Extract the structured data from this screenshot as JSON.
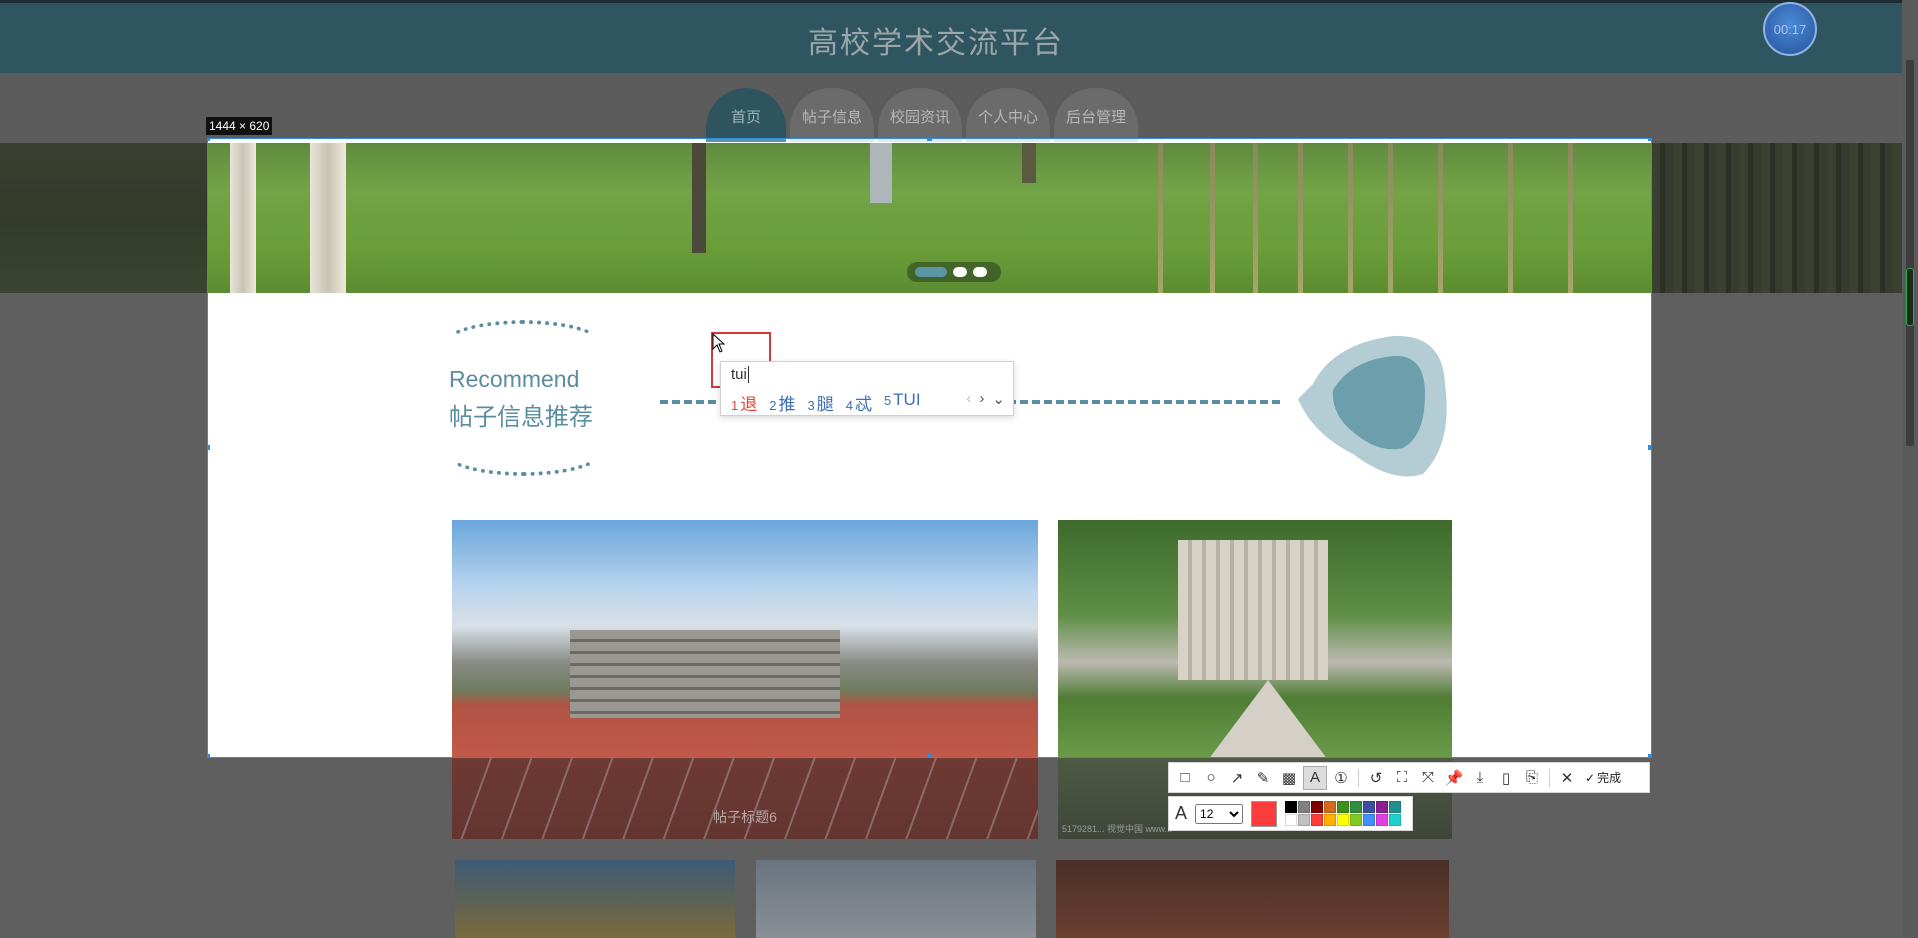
{
  "header": {
    "title": "高校学术交流平台"
  },
  "timer": {
    "text": "00:17"
  },
  "nav": {
    "items": [
      {
        "label": "首页",
        "active": true
      },
      {
        "label": "帖子信息",
        "active": false
      },
      {
        "label": "校园资讯",
        "active": false
      },
      {
        "label": "个人中心",
        "active": false
      },
      {
        "label": "后台管理",
        "active": false
      }
    ]
  },
  "capture": {
    "size_label": "1444 × 620"
  },
  "recommend": {
    "title_en": "Recommend",
    "title_cn": "帖子信息推荐"
  },
  "cards": [
    {
      "caption": "帖子标题6"
    },
    {
      "caption": "5179281... 视觉中国 www..."
    }
  ],
  "ime": {
    "composition": "tui",
    "candidates": [
      {
        "num": "1",
        "text": "退"
      },
      {
        "num": "2",
        "text": "推"
      },
      {
        "num": "3",
        "text": "腿"
      },
      {
        "num": "4",
        "text": "忒"
      },
      {
        "num": "5",
        "text": "TUI"
      }
    ],
    "arrows": {
      "prev": "‹",
      "next": "›",
      "expand": "⌄"
    }
  },
  "toolbar": {
    "tools": [
      {
        "name": "rectangle-tool-icon",
        "glyph": "□"
      },
      {
        "name": "ellipse-tool-icon",
        "glyph": "○"
      },
      {
        "name": "arrow-tool-icon",
        "glyph": "↗"
      },
      {
        "name": "pen-tool-icon",
        "glyph": "✎"
      },
      {
        "name": "mosaic-tool-icon",
        "glyph": "▩"
      },
      {
        "name": "text-tool-icon",
        "glyph": "A"
      },
      {
        "name": "number-tool-icon",
        "glyph": "①"
      },
      {
        "name": "undo-icon",
        "glyph": "↺"
      },
      {
        "name": "ocr-icon",
        "glyph": "⛶"
      },
      {
        "name": "scroll-capture-icon",
        "glyph": "⤧"
      },
      {
        "name": "pin-icon",
        "glyph": "📌"
      },
      {
        "name": "download-icon",
        "glyph": "⤓"
      },
      {
        "name": "phone-icon",
        "glyph": "▯"
      },
      {
        "name": "bookmark-icon",
        "glyph": "⎘"
      },
      {
        "name": "close-icon",
        "glyph": "✕"
      }
    ],
    "done_label": "完成",
    "font_size": "12",
    "current_color": "#ff3b3b",
    "palette": [
      "#000000",
      "#808080",
      "#800000",
      "#d4691e",
      "#3f8f1f",
      "#2f8f3f",
      "#3a4f9f",
      "#8a1f8f",
      "#1f8f8f",
      "#ffffff",
      "#c0c0c0",
      "#ff3b3b",
      "#ffb000",
      "#ffff00",
      "#80cc20",
      "#4090ff",
      "#e040e0",
      "#20d0d0"
    ]
  },
  "colors": {
    "accent": "#5b95a6",
    "header": "#2f5561",
    "selection": "#2d8ee0"
  }
}
